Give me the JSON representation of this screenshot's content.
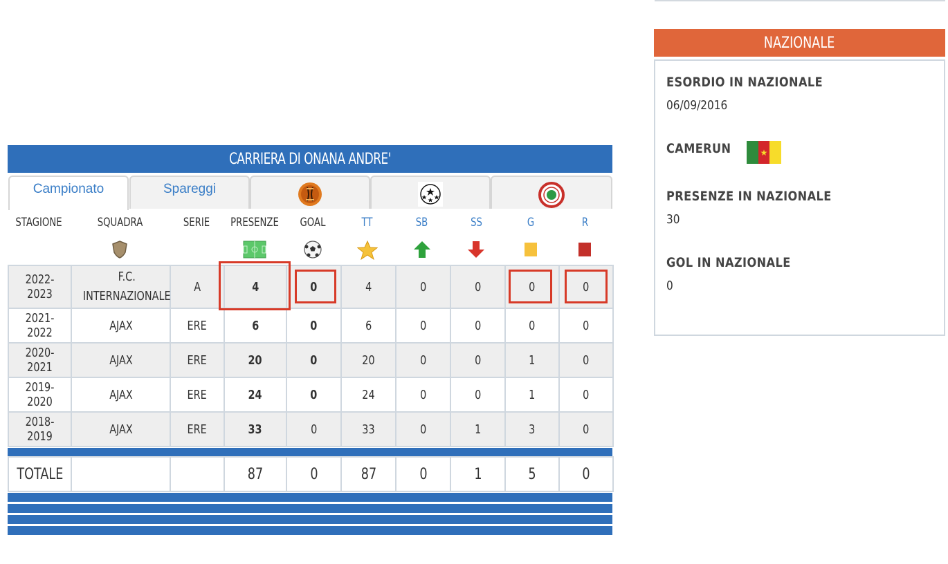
{
  "career": {
    "title": "CARRIERA DI ONANA ANDRE'",
    "tabs": [
      {
        "label": "Campionato",
        "icon": "",
        "active": true
      },
      {
        "label": "Spareggi",
        "icon": "",
        "active": false
      },
      {
        "label": "",
        "icon": "europa-league-icon",
        "active": false
      },
      {
        "label": "",
        "icon": "champions-league-icon",
        "active": false
      },
      {
        "label": "",
        "icon": "coppa-italia-icon",
        "active": false
      }
    ],
    "columns": [
      "STAGIONE",
      "SQUADRA",
      "SERIE",
      "PRESENZE",
      "GOAL",
      "TT",
      "SB",
      "SS",
      "G",
      "R"
    ],
    "column_icons": [
      "",
      "shield-icon",
      "",
      "pitch-icon",
      "ball-icon",
      "star-icon",
      "arrow-up-icon",
      "arrow-down-icon",
      "yellow-card-icon",
      "red-card-icon"
    ],
    "rows": [
      {
        "stagione": "2022-2023",
        "squadra": "F.C. INTERNAZIONALE",
        "serie": "A",
        "presenze": "4",
        "goal": "0",
        "tt": "4",
        "sb": "0",
        "ss": "0",
        "g": "0",
        "r": "0"
      },
      {
        "stagione": "2021-2022",
        "squadra": "AJAX",
        "serie": "ERE",
        "presenze": "6",
        "goal": "0",
        "tt": "6",
        "sb": "0",
        "ss": "0",
        "g": "0",
        "r": "0"
      },
      {
        "stagione": "2020-2021",
        "squadra": "AJAX",
        "serie": "ERE",
        "presenze": "20",
        "goal": "0",
        "tt": "20",
        "sb": "0",
        "ss": "0",
        "g": "1",
        "r": "0"
      },
      {
        "stagione": "2019-2020",
        "squadra": "AJAX",
        "serie": "ERE",
        "presenze": "24",
        "goal": "0",
        "tt": "24",
        "sb": "0",
        "ss": "0",
        "g": "1",
        "r": "0"
      },
      {
        "stagione": "2018-2019",
        "squadra": "AJAX",
        "serie": "ERE",
        "presenze": "33",
        "goal": "0",
        "tt": "33",
        "sb": "0",
        "ss": "1",
        "g": "3",
        "r": "0"
      }
    ],
    "total": {
      "label": "TOTALE",
      "squadra": "",
      "serie": "",
      "presenze": "87",
      "goal": "0",
      "tt": "87",
      "sb": "0",
      "ss": "1",
      "g": "5",
      "r": "0"
    }
  },
  "nazionale": {
    "title": "NAZIONALE",
    "esordio_label": "ESORDIO IN NAZIONALE",
    "esordio_value": "06/09/2016",
    "country": "CAMERUN",
    "presenze_label": "PRESENZE IN NAZIONALE",
    "presenze_value": "30",
    "gol_label": "GOL IN NAZIONALE",
    "gol_value": "0"
  },
  "colors": {
    "career_header": "#2f6fba",
    "nazionale_header": "#e0663a",
    "highlight": "#d73a28",
    "flag": [
      "#2e8b3c",
      "#d3262b",
      "#f7dc2a"
    ]
  }
}
